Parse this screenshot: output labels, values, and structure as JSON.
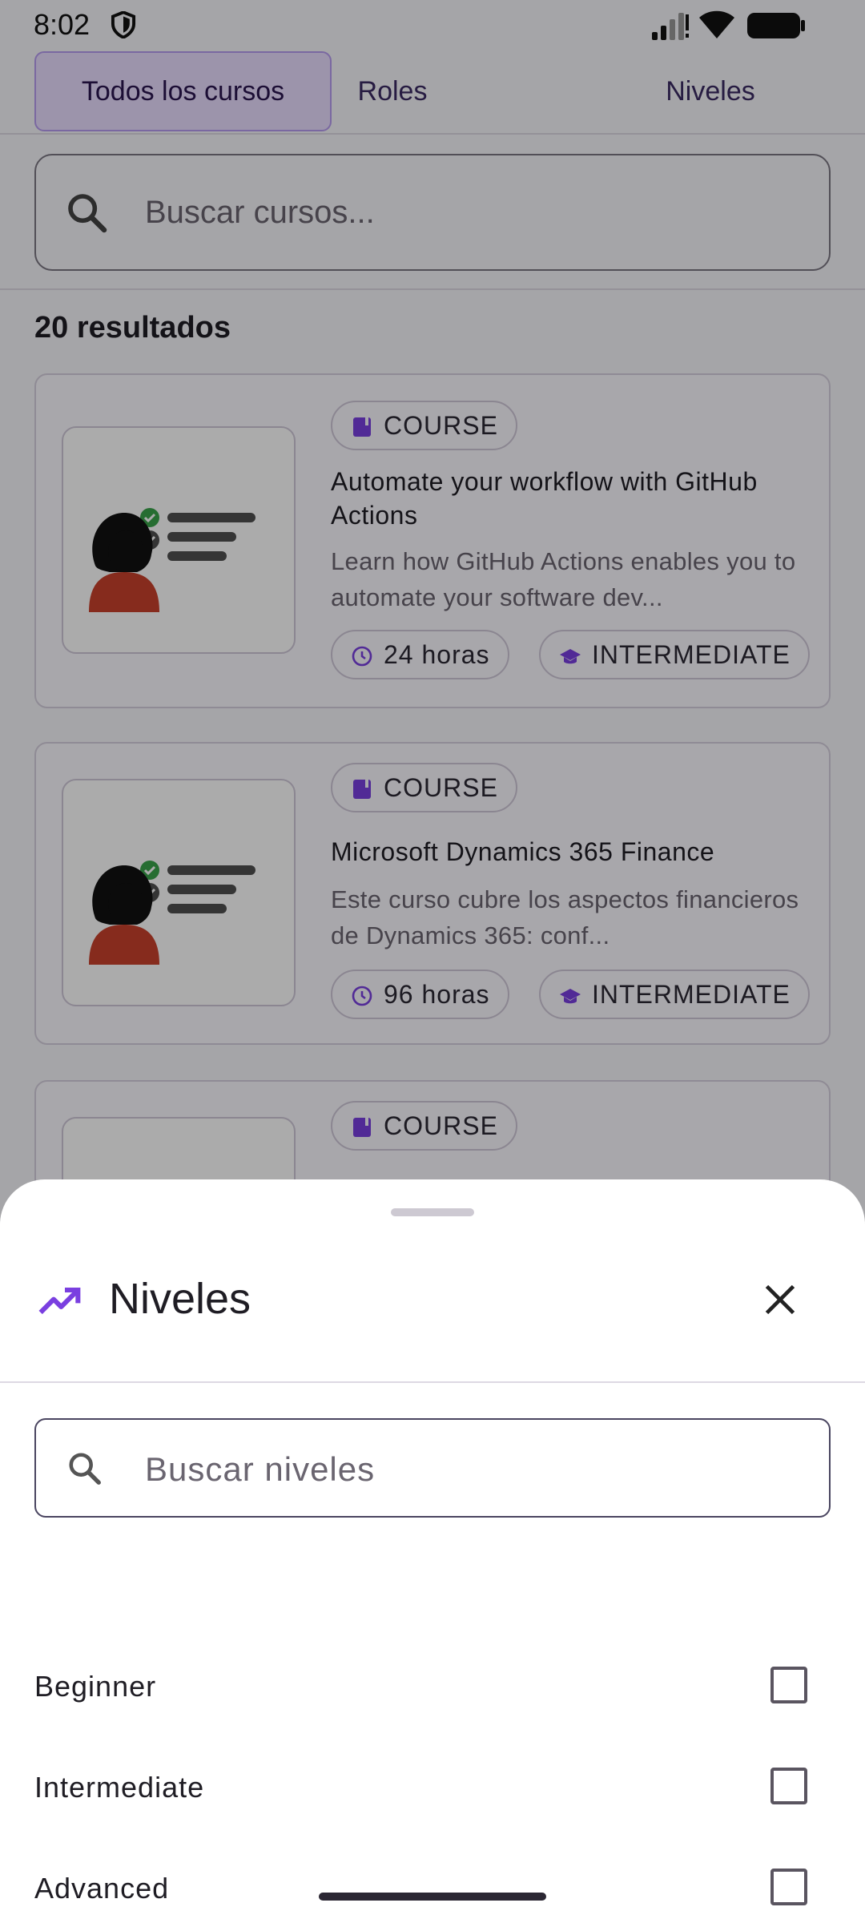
{
  "status_bar": {
    "time": "8:02",
    "icons": [
      "shield-icon",
      "signal-icon",
      "wifi-icon",
      "battery-icon"
    ]
  },
  "tabs": [
    {
      "label": "Todos los cursos",
      "selected": true
    },
    {
      "label": "Roles",
      "selected": false
    },
    {
      "label": "Niveles",
      "selected": false
    }
  ],
  "search": {
    "placeholder": "Buscar cursos...",
    "icon": "search-icon"
  },
  "results_count": "20 resultados",
  "courses": [
    {
      "type": "COURSE",
      "title": "Automate your workflow with GitHub Actions",
      "description": "Learn how GitHub Actions enables you to automate your software dev...",
      "duration": "24 horas",
      "level": "INTERMEDIATE"
    },
    {
      "type": "COURSE",
      "title": "Microsoft Dynamics 365 Finance",
      "description": "Este curso cubre los aspectos financieros de Dynamics 365: conf...",
      "duration": "96 horas",
      "level": "INTERMEDIATE"
    },
    {
      "type": "COURSE",
      "title": "",
      "description": "",
      "duration": "",
      "level": ""
    }
  ],
  "sheet": {
    "title": "Niveles",
    "title_icon": "trending-up-icon",
    "search_placeholder": "Buscar niveles",
    "options": [
      {
        "label": "Beginner",
        "checked": false
      },
      {
        "label": "Intermediate",
        "checked": false
      },
      {
        "label": "Advanced",
        "checked": false
      }
    ]
  },
  "colors": {
    "accent": "#7a3fe0",
    "tab_selected_bg": "#e9ddff",
    "checkmark_green": "#3aa34a",
    "figure_red": "#c8402c"
  }
}
